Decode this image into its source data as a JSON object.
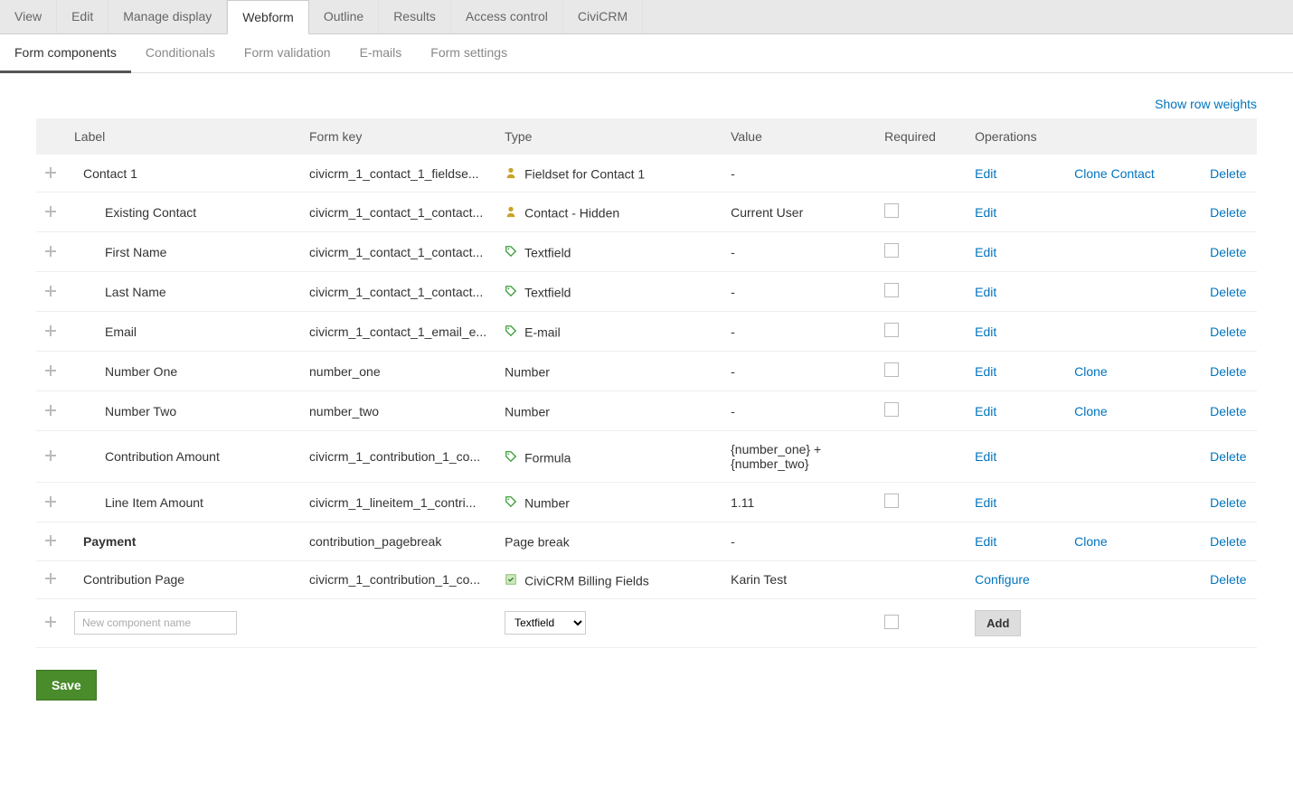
{
  "primary_tabs": [
    {
      "label": "View",
      "active": false
    },
    {
      "label": "Edit",
      "active": false
    },
    {
      "label": "Manage display",
      "active": false
    },
    {
      "label": "Webform",
      "active": true
    },
    {
      "label": "Outline",
      "active": false
    },
    {
      "label": "Results",
      "active": false
    },
    {
      "label": "Access control",
      "active": false
    },
    {
      "label": "CiviCRM",
      "active": false
    }
  ],
  "secondary_tabs": [
    {
      "label": "Form components",
      "active": true
    },
    {
      "label": "Conditionals",
      "active": false
    },
    {
      "label": "Form validation",
      "active": false
    },
    {
      "label": "E-mails",
      "active": false
    },
    {
      "label": "Form settings",
      "active": false
    }
  ],
  "show_row_weights": "Show row weights",
  "headers": {
    "label": "Label",
    "form_key": "Form key",
    "type": "Type",
    "value": "Value",
    "required": "Required",
    "operations": "Operations"
  },
  "ops_labels": {
    "edit": "Edit",
    "clone": "Clone",
    "clone_contact": "Clone Contact",
    "delete": "Delete",
    "configure": "Configure"
  },
  "rows": [
    {
      "indent": 0,
      "strong": false,
      "label": "Contact 1",
      "form_key": "civicrm_1_contact_1_fieldse...",
      "type_icon": "person",
      "type": "Fieldset for Contact 1",
      "value": "-",
      "required": null,
      "ops": [
        "edit",
        "clone_contact",
        "delete"
      ],
      "page_boundary": false
    },
    {
      "indent": 1,
      "strong": false,
      "label": "Existing Contact",
      "form_key": "civicrm_1_contact_1_contact...",
      "type_icon": "person",
      "type": "Contact - Hidden",
      "value": "Current User",
      "required": false,
      "ops": [
        "edit",
        "",
        "delete"
      ],
      "page_boundary": false
    },
    {
      "indent": 1,
      "strong": false,
      "label": "First Name",
      "form_key": "civicrm_1_contact_1_contact...",
      "type_icon": "tag",
      "type": "Textfield",
      "value": "-",
      "required": false,
      "ops": [
        "edit",
        "",
        "delete"
      ],
      "page_boundary": false
    },
    {
      "indent": 1,
      "strong": false,
      "label": "Last Name",
      "form_key": "civicrm_1_contact_1_contact...",
      "type_icon": "tag",
      "type": "Textfield",
      "value": "-",
      "required": false,
      "ops": [
        "edit",
        "",
        "delete"
      ],
      "page_boundary": false
    },
    {
      "indent": 1,
      "strong": false,
      "label": "Email",
      "form_key": "civicrm_1_contact_1_email_e...",
      "type_icon": "tag",
      "type": "E-mail",
      "value": "-",
      "required": false,
      "ops": [
        "edit",
        "",
        "delete"
      ],
      "page_boundary": false
    },
    {
      "indent": 1,
      "strong": false,
      "label": "Number One",
      "form_key": "number_one",
      "type_icon": "",
      "type": "Number",
      "value": "-",
      "required": false,
      "ops": [
        "edit",
        "clone",
        "delete"
      ],
      "page_boundary": false
    },
    {
      "indent": 1,
      "strong": false,
      "label": "Number Two",
      "form_key": "number_two",
      "type_icon": "",
      "type": "Number",
      "value": "-",
      "required": false,
      "ops": [
        "edit",
        "clone",
        "delete"
      ],
      "page_boundary": false
    },
    {
      "indent": 1,
      "strong": false,
      "label": "Contribution Amount",
      "form_key": "civicrm_1_contribution_1_co...",
      "type_icon": "tag",
      "type": "Formula",
      "value": "{number_one} + {number_two}",
      "required": null,
      "ops": [
        "edit",
        "",
        "delete"
      ],
      "page_boundary": false
    },
    {
      "indent": 1,
      "strong": false,
      "label": "Line Item Amount",
      "form_key": "civicrm_1_lineitem_1_contri...",
      "type_icon": "tag",
      "type": "Number",
      "value": "1.11",
      "required": false,
      "ops": [
        "edit",
        "",
        "delete"
      ],
      "page_boundary": false
    },
    {
      "indent": 0,
      "strong": true,
      "label": "Payment",
      "form_key": "contribution_pagebreak",
      "type_icon": "",
      "type": "Page break",
      "value": "-",
      "required": null,
      "ops": [
        "edit",
        "clone",
        "delete"
      ],
      "page_boundary": true
    },
    {
      "indent": 0,
      "strong": false,
      "label": "Contribution Page",
      "form_key": "civicrm_1_contribution_1_co...",
      "type_icon": "civi",
      "type": "CiviCRM Billing Fields",
      "value": "Karin Test",
      "required": null,
      "ops": [
        "configure",
        "",
        "delete"
      ],
      "page_boundary": false
    }
  ],
  "new_row": {
    "placeholder": "New component name",
    "type_options": [
      "Textfield"
    ],
    "selected_type": "Textfield",
    "add_label": "Add"
  },
  "save_label": "Save"
}
